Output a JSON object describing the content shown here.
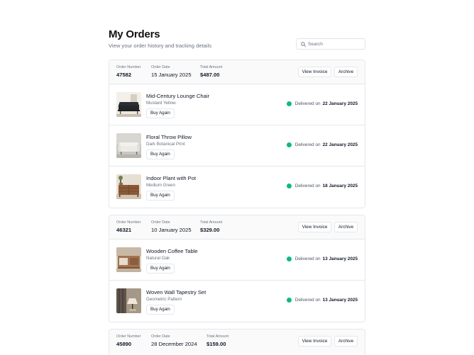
{
  "header": {
    "title": "My Orders",
    "subtitle": "View your order history and tracking details"
  },
  "search": {
    "placeholder": "Search"
  },
  "labels": {
    "order_number": "Order Number",
    "order_date": "Order Date",
    "total_amount": "Total Amount",
    "view_invoice": "View Invoice",
    "archive": "Archive",
    "buy_again": "Buy Again",
    "delivered_prefix": "Delivered on"
  },
  "colors": {
    "status_delivered": "#10b981",
    "border": "#e5e7eb"
  },
  "orders": [
    {
      "number": "47582",
      "date": "15 January 2025",
      "total": "$487.00",
      "items": [
        {
          "name": "Mid-Century Lounge Chair",
          "variant": "Mustard Yellow",
          "status": "delivered",
          "delivered_date": "22 January 2025",
          "image": "dark-sofa-photo"
        },
        {
          "name": "Floral Throw Pillow",
          "variant": "Dark Botanical Print",
          "status": "delivered",
          "delivered_date": "22 January 2025",
          "image": "white-sofa-photo"
        },
        {
          "name": "Indoor Plant with Pot",
          "variant": "Medium Green",
          "status": "delivered",
          "delivered_date": "18 January 2025",
          "image": "wooden-dresser-photo"
        }
      ]
    },
    {
      "number": "46321",
      "date": "10 January 2025",
      "total": "$329.00",
      "items": [
        {
          "name": "Wooden Coffee Table",
          "variant": "Natural Oak",
          "status": "delivered",
          "delivered_date": "13 January 2025",
          "image": "wooden-console-photo"
        },
        {
          "name": "Woven Wall Tapestry Set",
          "variant": "Geometric Pattern",
          "status": "delivered",
          "delivered_date": "13 January 2025",
          "image": "lamp-room-photo"
        }
      ]
    },
    {
      "number": "45890",
      "date": "28 December 2024",
      "total": "$159.00",
      "items": []
    }
  ]
}
